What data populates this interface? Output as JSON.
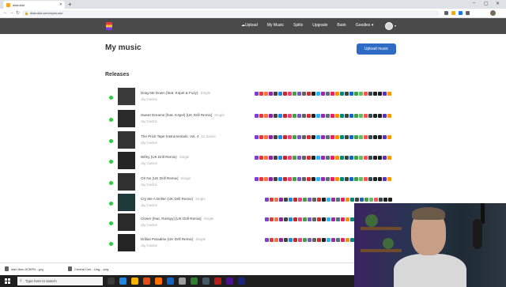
{
  "browser": {
    "tab_title": "distrokid",
    "url": "distrokid.com/mymusic/"
  },
  "site_nav": {
    "links": [
      "Upload",
      "My Music",
      "Splits",
      "Upgrade",
      "Bank",
      "Goodies ▾"
    ]
  },
  "page": {
    "title": "My music",
    "upload_button": "Upload music",
    "section_title": "Releases"
  },
  "releases": [
    {
      "title": "Drag Me Down (feat. K4pel & Fuzy)",
      "type": "Single",
      "artist": "Jay Cactus",
      "cover": "#3a3a3a"
    },
    {
      "title": "Sweet Dreams (feat. K4pel) [UK Drill Remix]",
      "type": "Single",
      "artist": "Jay Cactus",
      "cover": "#2b2b2b"
    },
    {
      "title": "The Prick Tape Instrumentals, Vol. 4",
      "type": "11 tracks",
      "artist": "Jay Cactus",
      "cover": "#333333"
    },
    {
      "title": "Wifey (UK Drill Remix)",
      "type": "Single",
      "artist": "Jay Cactus",
      "cover": "#262626"
    },
    {
      "title": "Oh No (UK Drill Remix)",
      "type": "Single",
      "artist": "Jay Cactus",
      "cover": "#303030"
    },
    {
      "title": "Cry Me A Driller (UK Drill Remix)",
      "type": "Single",
      "artist": "Jay Cactus",
      "cover": "#1f3a3a"
    },
    {
      "title": "Closer (feat. Rossyy) [UK Drill Remix]",
      "type": "Single",
      "artist": "Jay Cactus",
      "cover": "#2a2a2a"
    },
    {
      "title": "Drillas Paradise (UK Drill Remix)",
      "type": "Single",
      "artist": "Jay Cactus",
      "cover": "#242424"
    }
  ],
  "store_icon_colors": [
    "#7b3fd1",
    "#e53935",
    "#ff7043",
    "#8e24aa",
    "#424242",
    "#1e88e5",
    "#c62828",
    "#ec407a",
    "#43a047",
    "#7e57c2",
    "#616161",
    "#d32f2f",
    "#212121",
    "#29b6f6",
    "#9c27b0",
    "#546e7a",
    "#e91e63",
    "#ff8f00",
    "#00897b",
    "#424242",
    "#1565c0",
    "#43a047",
    "#66bb6a",
    "#ff5252",
    "#37474f",
    "#212121",
    "#212121",
    "#5e35b1",
    "#ff9800"
  ],
  "downloads": [
    {
      "name": "stan-lbon-0CBFN....jpg"
    },
    {
      "name": "Central Cee - Ung....png"
    }
  ],
  "taskbar": {
    "search_placeholder": "Type here to search"
  },
  "accent_colors": {
    "nav_bg": "#4a4a4a",
    "button_blue": "#2e6bc6",
    "status_green": "#2ecc40"
  }
}
